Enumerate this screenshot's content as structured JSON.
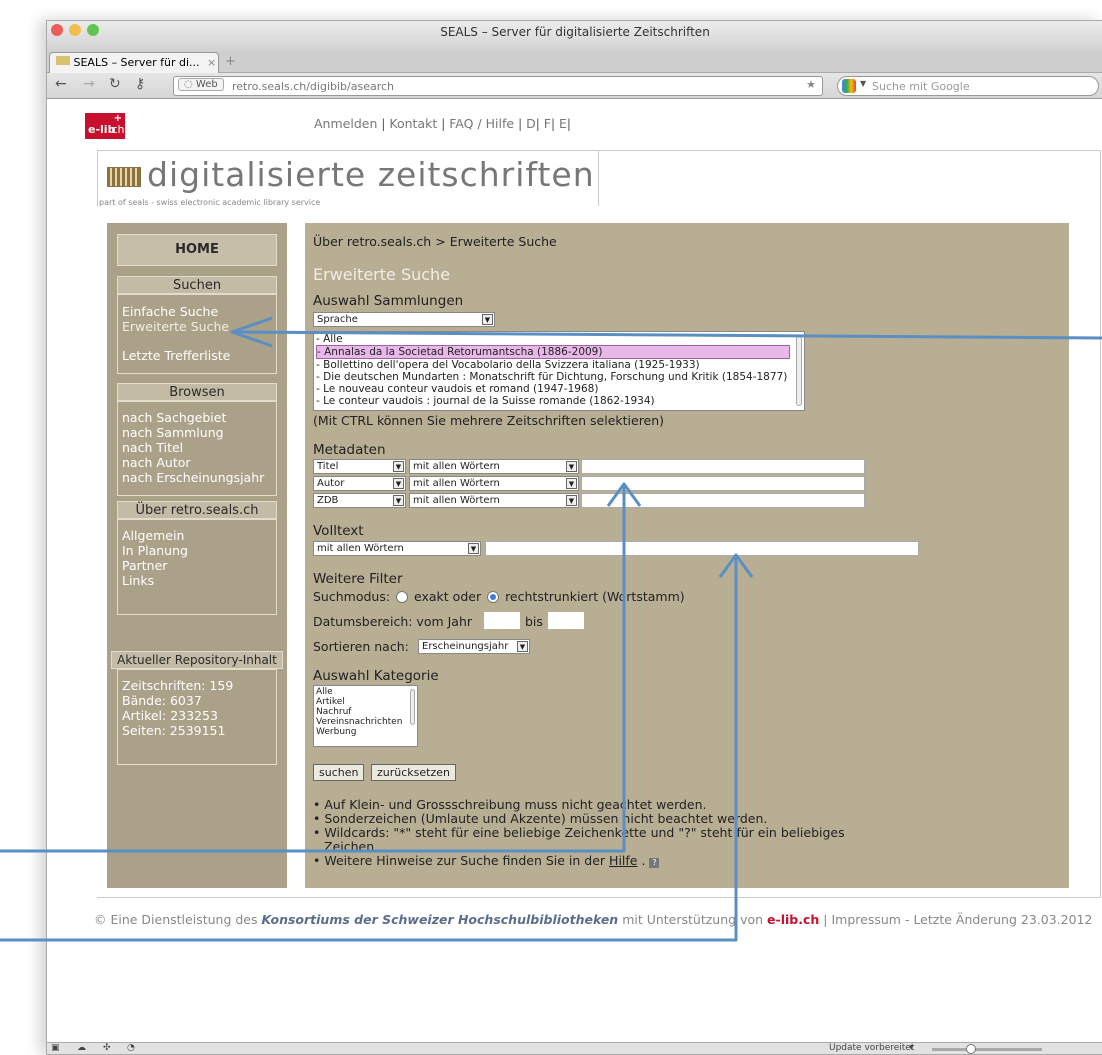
{
  "browser": {
    "window_title": "SEALS – Server für digitalisierte Zeitschriften",
    "tab_label": "SEALS – Server für di...",
    "tab_icon": "seals-favicon",
    "tab_close": "×",
    "new_tab": "+",
    "url_web_label": "Web",
    "url": "retro.seals.ch/digibib/asearch",
    "url_bold": "seals.ch",
    "search_placeholder": "Suche mit Google",
    "status_text": "Update vorbereitet"
  },
  "topnav": {
    "login": "Anmelden",
    "contact": "Kontakt",
    "faq": "FAQ / Hilfe",
    "lang_d": "D",
    "lang_f": "F",
    "lang_e": "E",
    "sep": "|"
  },
  "logo": {
    "elib_text": "e-lib",
    "elib_ch": ".ch",
    "site_title": "digitalisierte zeitschriften",
    "subtitle": "part of seals - swiss electronic academic library service"
  },
  "sidebar": {
    "home": "HOME",
    "search_head": "Suchen",
    "simple_search": "Einfache Suche",
    "advanced_search": "Erweiterte Suche",
    "last_results": "Letzte Trefferliste",
    "browse_head": "Browsen",
    "browse_items": [
      "nach Sachgebiet",
      "nach Sammlung",
      "nach Titel",
      "nach Autor",
      "nach Erscheinungsjahr"
    ],
    "about_head": "Über retro.seals.ch",
    "about_items": [
      "Allgemein",
      "In Planung",
      "Partner",
      "Links"
    ],
    "repo_head": "Aktueller Repository-Inhalt",
    "repo_items": [
      "Zeitschriften: 159",
      "Bände: 6037",
      "Artikel: 233253",
      "Seiten: 2539151"
    ]
  },
  "main": {
    "breadcrumb_home": "Über retro.seals.ch",
    "breadcrumb_sep": ">",
    "breadcrumb_current": "Erweiterte Suche",
    "page_title": "Erweiterte Suche",
    "collections_head": "Auswahl Sammlungen",
    "collections_select": "Sprache",
    "collections": [
      "- Alle",
      "- Annalas da la Societad Retorumantscha (1886-2009)",
      "- Bollettino dell'opera del Vocabolario della Svizzera italiana (1925-1933)",
      "- Die deutschen Mundarten : Monatschrift für Dichtung, Forschung und Kritik (1854-1877)",
      "- Le nouveau conteur vaudois et romand (1947-1968)",
      "-    Le conteur vaudois : journal de la Suisse romande (1862-1934)"
    ],
    "collections_hint": "(Mit CTRL können Sie mehrere Zeitschriften selektieren)",
    "metadata_head": "Metadaten",
    "metadata_rows": [
      {
        "field": "Titel",
        "mode": "mit allen Wörtern"
      },
      {
        "field": "Autor",
        "mode": "mit allen Wörtern"
      },
      {
        "field": "ZDB",
        "mode": "mit allen Wörtern"
      }
    ],
    "fulltext_head": "Volltext",
    "fulltext_mode": "mit allen Wörtern",
    "filter_head": "Weitere Filter",
    "search_mode_label": "Suchmodus:",
    "search_mode_exact": "exakt oder",
    "search_mode_trunc": "rechtstrunkiert (Wortstamm)",
    "date_range_label": "Datumsbereich: vom Jahr",
    "date_to": "bis",
    "sort_label": "Sortieren nach:",
    "sort_value": "Erscheinungsjahr",
    "category_head": "Auswahl Kategorie",
    "categories": [
      "Alle",
      "Artikel",
      "Nachruf",
      "Vereinsnachrichten",
      "Werbung"
    ],
    "btn_search": "suchen",
    "btn_reset": "zurücksetzen",
    "hints": [
      "Auf Klein- und Grossschreibung muss nicht geachtet werden.",
      "Sonderzeichen (Umlaute und Akzente) müssen nicht beachtet werden.",
      "Wildcards: \"*\" steht für eine beliebige Zeichenkette und \"?\" steht für ein beliebiges",
      "Zeichen.",
      "Weitere Hinweise zur Suche finden Sie in der"
    ],
    "hint_link": "Hilfe",
    "hint_end": "."
  },
  "footer": {
    "prefix": "© Eine Dienstleistung des",
    "consortium": "Konsortiums der Schweizer Hochschulbibliotheken",
    "mid": "mit Unterstützung von",
    "elib": "e-lib.ch",
    "impressum": "Impressum",
    "last_change": "Letzte Änderung 23.03.2012",
    "sep": "|",
    "dash": "-"
  },
  "colors": {
    "sidebar_bg": "#aba189",
    "main_bg": "#b8ae94",
    "annotation_arrow": "#5b8fc4",
    "elib_red": "#c8102e"
  }
}
